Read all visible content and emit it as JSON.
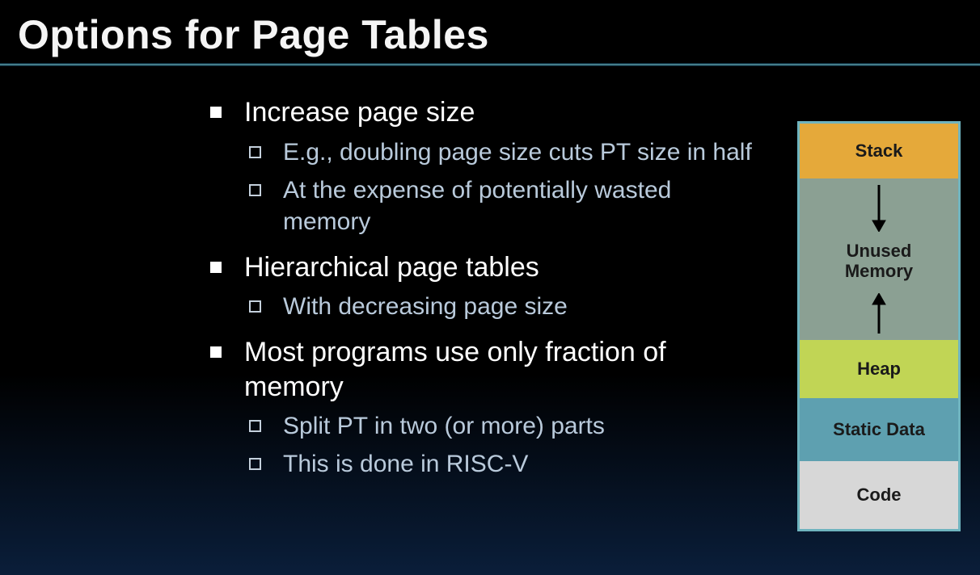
{
  "title": "Options for Page Tables",
  "bullets": {
    "b1": "Increase page size",
    "b1a": "E.g., doubling page size cuts PT size in half",
    "b1b": "At the expense of potentially wasted memory",
    "b2": "Hierarchical page tables",
    "b2a": "With decreasing page size",
    "b3": "Most programs use only fraction of memory",
    "b3a": "Split PT in two (or more) parts",
    "b3b": "This is done in RISC-V"
  },
  "diagram": {
    "stack": "Stack",
    "unused_l1": "Unused",
    "unused_l2": "Memory",
    "heap": "Heap",
    "static": "Static Data",
    "code": "Code"
  }
}
